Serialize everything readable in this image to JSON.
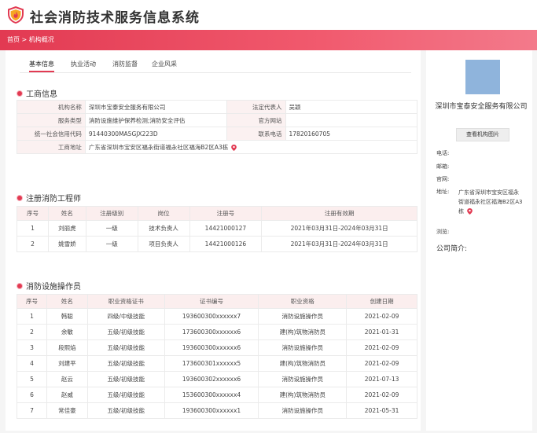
{
  "app": {
    "title": "社会消防技术服务信息系统"
  },
  "breadcrumb": {
    "home": "首页",
    "sep": ">",
    "current": "机构概况"
  },
  "tabs": [
    "基本信息",
    "执业活动",
    "消防监督",
    "企业风采"
  ],
  "business": {
    "title": "工商信息",
    "org_name_label": "机构名称",
    "org_name": "深圳市宝泰安全服务有限公司",
    "legal_rep_label": "法定代表人",
    "legal_rep": "吴颖",
    "service_type_label": "服务类型",
    "service_type": "消防设施维护保养检测;消防安全评估",
    "website_label": "官方网站",
    "website": "",
    "credit_code_label": "统一社会信用代码",
    "credit_code": "91440300MA5GJX223D",
    "phone_label": "联系电话",
    "phone": "17820160705",
    "address_label": "工商地址",
    "address": "广东省深圳市宝安区福永街道福永社区福海B2区A3栋"
  },
  "engineers": {
    "title": "注册消防工程师",
    "headers": [
      "序号",
      "姓名",
      "注册级别",
      "岗位",
      "注册号",
      "注册有效期"
    ],
    "rows": [
      [
        "1",
        "刘丽虎",
        "一级",
        "技术负责人",
        "14421000127",
        "2021年03月31日-2024年03月31日"
      ],
      [
        "2",
        "姚雪娇",
        "一级",
        "项目负责人",
        "14421000126",
        "2021年03月31日-2024年03月31日"
      ]
    ]
  },
  "operators": {
    "title": "消防设施操作员",
    "headers": [
      "序号",
      "姓名",
      "职业资格证书",
      "证书编号",
      "职业资格",
      "创建日期"
    ],
    "rows": [
      [
        "1",
        "韩聪",
        "四级/中级技能",
        "193600300xxxxxx7",
        "消防设施操作员",
        "2021-02-09"
      ],
      [
        "2",
        "余敏",
        "五级/初级技能",
        "173600300xxxxxx6",
        "建(构)筑物消防员",
        "2021-01-31"
      ],
      [
        "3",
        "段熙焰",
        "五级/初级技能",
        "193600300xxxxxx6",
        "消防设施操作员",
        "2021-02-09"
      ],
      [
        "4",
        "刘建平",
        "五级/初级技能",
        "173600301xxxxxx5",
        "建(构)筑物消防员",
        "2021-02-09"
      ],
      [
        "5",
        "赵云",
        "五级/初级技能",
        "193600302xxxxxx6",
        "消防设施操作员",
        "2021-07-13"
      ],
      [
        "6",
        "赵威",
        "五级/初级技能",
        "153600300xxxxxx4",
        "建(构)筑物消防员",
        "2021-02-09"
      ],
      [
        "7",
        "常佳豪",
        "五级/初级技能",
        "193600300xxxxxx1",
        "消防设施操作员",
        "2021-05-31"
      ]
    ]
  },
  "sidebar": {
    "company_name": "深圳市宝泰安全服务有限公司",
    "view_button": "查看机构图片",
    "phone_label": "电话:",
    "phone": "",
    "mail_label": "邮箱:",
    "mail": "",
    "website_label": "官网:",
    "website": "",
    "address_label": "地址:",
    "address": "广东省深圳市宝安区福永街道福永社区福海B2区A3栋",
    "visits_label": "浏览:",
    "visits": "",
    "intro_label": "公司简介:"
  },
  "colors": {
    "accent": "#e23a52",
    "header_bg": "#fbeeee",
    "image_placeholder": "#8fb4dc"
  }
}
